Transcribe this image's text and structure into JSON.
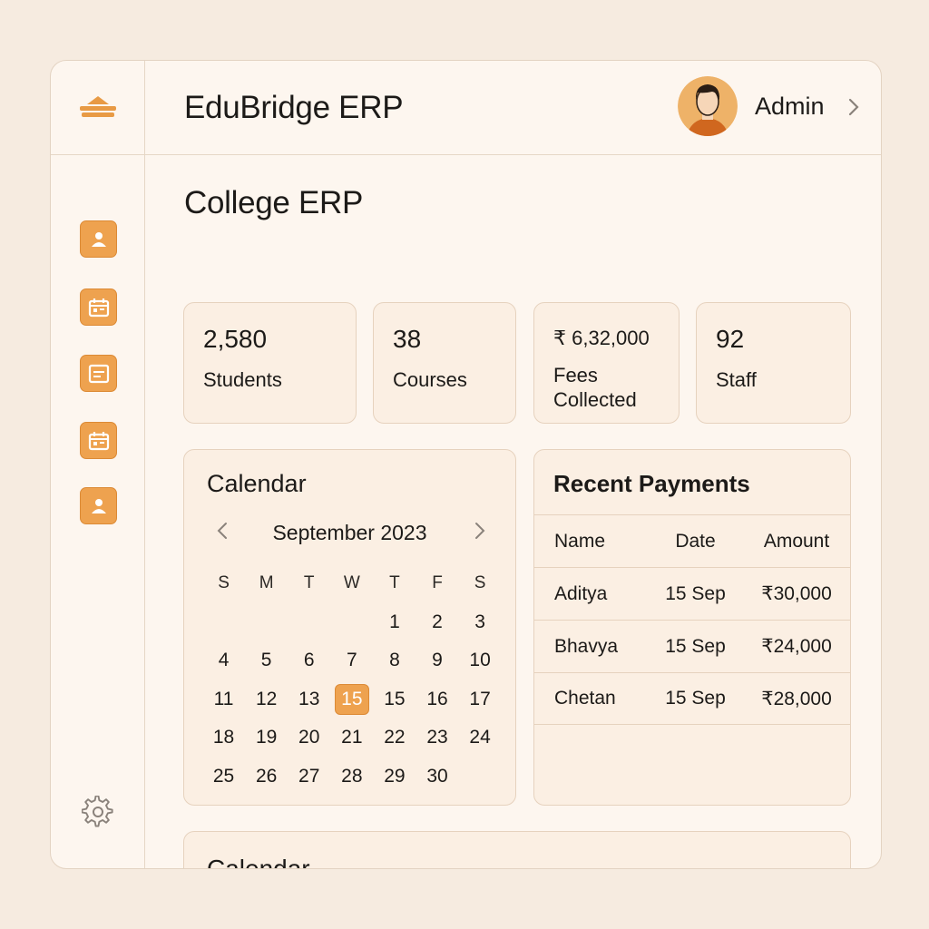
{
  "header": {
    "app_title": "EduBridge ERP",
    "user_name": "Admin"
  },
  "sidebar": {
    "items": [
      {
        "icon": "user-icon"
      },
      {
        "icon": "calendar-icon"
      },
      {
        "icon": "document-icon"
      },
      {
        "icon": "calendar-icon"
      },
      {
        "icon": "user-icon"
      }
    ],
    "settings_icon": "gear-icon"
  },
  "main": {
    "page_title": "College ERP",
    "stats": [
      {
        "value": "2,580",
        "label": "Students"
      },
      {
        "value": "38",
        "label": "Courses"
      },
      {
        "value": "₹ 6,32,000",
        "label_line1": "Fees",
        "label_line2": "Collected"
      },
      {
        "value": "92",
        "label": "Staff"
      }
    ],
    "calendar": {
      "title": "Calendar",
      "month": "September 2023",
      "weekdays": [
        "S",
        "M",
        "T",
        "W",
        "T",
        "F",
        "S"
      ],
      "weeks": [
        [
          "",
          "",
          "",
          "",
          "1",
          "2",
          "3"
        ],
        [
          "4",
          "5",
          "6",
          "7",
          "8",
          "9",
          "10"
        ],
        [
          "11",
          "12",
          "13",
          "15",
          "15",
          "16",
          "17"
        ],
        [
          "18",
          "19",
          "20",
          "21",
          "22",
          "23",
          "24"
        ],
        [
          "25",
          "26",
          "27",
          "28",
          "29",
          "30",
          ""
        ]
      ],
      "selected_day": "15"
    },
    "payments": {
      "title": "Recent Payments",
      "columns": [
        "Name",
        "Date",
        "Amount"
      ],
      "rows": [
        [
          "Aditya",
          "15 Sep",
          "₹30,000"
        ],
        [
          "Bhavya",
          "15 Sep",
          "₹24,000"
        ],
        [
          "Chetan",
          "15 Sep",
          "₹28,000"
        ]
      ]
    },
    "bottom_card": {
      "title": "Calendar"
    }
  },
  "colors": {
    "accent": "#eea24f",
    "background": "#f6ebe0",
    "panel": "#fdf6ef",
    "card": "#fbefe3"
  }
}
